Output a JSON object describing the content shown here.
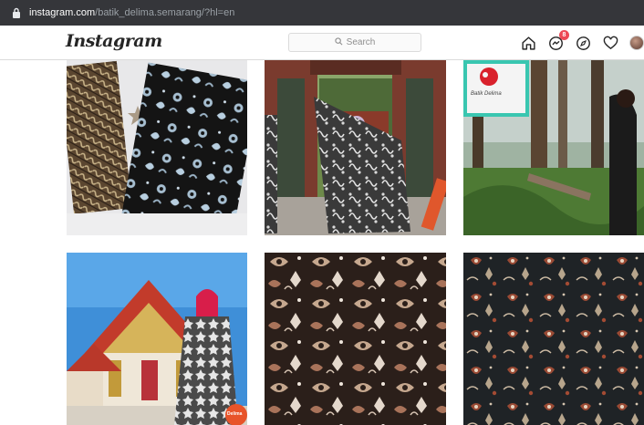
{
  "browser": {
    "url_domain": "instagram.com",
    "url_path": "/batik_delima.semarang/?hl=en"
  },
  "header": {
    "logo": "Instagram",
    "search_placeholder": "Search",
    "notification_count": "8",
    "icons": [
      "home-icon",
      "messenger-icon",
      "explore-icon",
      "heart-icon",
      "avatar"
    ]
  },
  "posts": [
    {
      "id": "post-1",
      "content": "batik fabric flat lay with brown parang and black floral"
    },
    {
      "id": "post-2",
      "content": "woman holding batik cloth at carved gate"
    },
    {
      "id": "post-3",
      "content": "forest scene with batik logo",
      "logo_text": "Batik Delima"
    },
    {
      "id": "post-4",
      "content": "woman in batik at Thai temple",
      "badge_text": "Delima"
    },
    {
      "id": "post-5",
      "content": "brown and white batik pattern close up"
    },
    {
      "id": "post-6",
      "content": "dark batik pattern with red motifs"
    }
  ],
  "colors": {
    "notification": "#ed4956",
    "header_border": "#dbdbdb",
    "address_bar": "#35363a"
  }
}
